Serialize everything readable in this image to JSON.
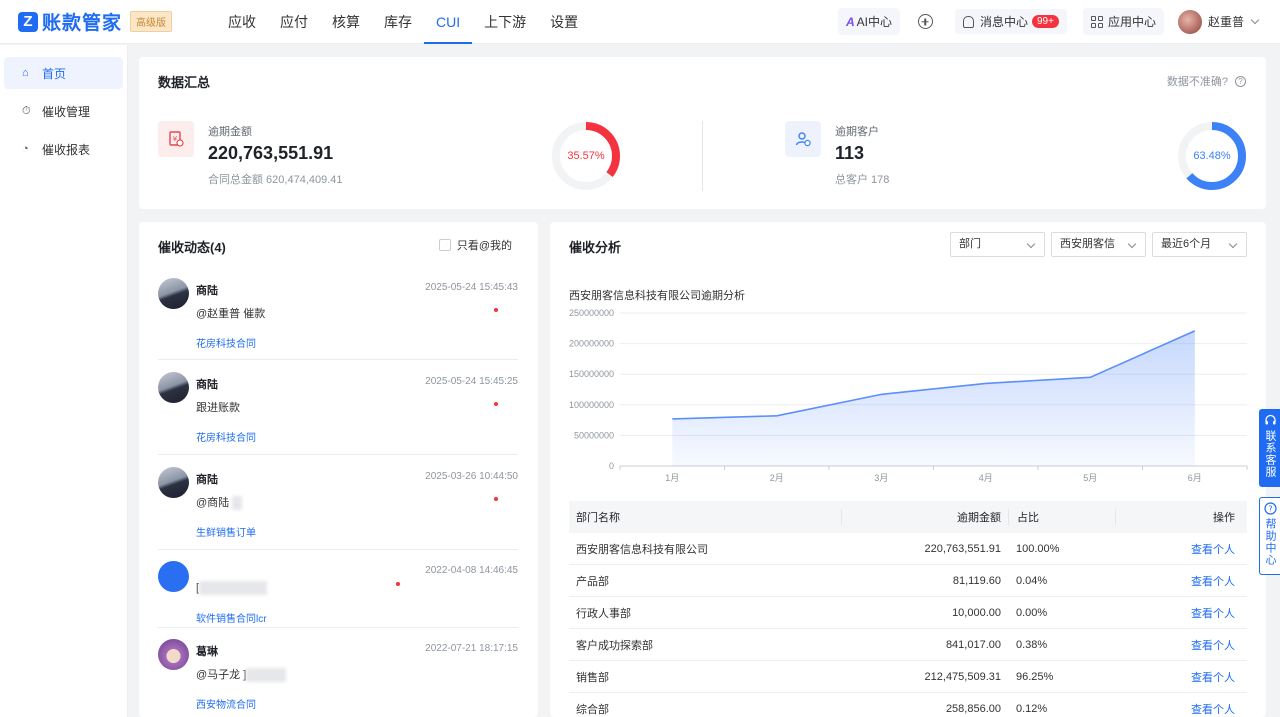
{
  "app": {
    "logo_mark": "Z",
    "name": "账款管家",
    "badge": "高级版"
  },
  "nav": [
    "应收",
    "应付",
    "核算",
    "库存",
    "CUI",
    "上下游",
    "设置"
  ],
  "nav_active": "CUI",
  "topright": {
    "ai_icon": "A",
    "ai_label": "AI中心",
    "msg_label": "消息中心",
    "msg_badge": "99+",
    "app_label": "应用中心",
    "user_name": "赵重普"
  },
  "sidebar": [
    {
      "icon": "home-icon",
      "glyph": "⌂",
      "label": "首页",
      "active": true
    },
    {
      "icon": "timer-icon",
      "glyph": "⏱",
      "label": "催收管理",
      "active": false
    },
    {
      "icon": "report-icon",
      "glyph": "◔",
      "label": "催收报表",
      "active": false
    }
  ],
  "summary": {
    "title": "数据汇总",
    "inaccurate": "数据不准确?",
    "overdue_amount": {
      "label": "逾期金额",
      "value": "220,763,551.91",
      "sub": "合同总金额 620,474,409.41",
      "percent_text": "35.57%",
      "percent": 35.57,
      "color": "#f5333f"
    },
    "overdue_customers": {
      "label": "逾期客户",
      "value": "113",
      "sub": "总客户 178",
      "percent_text": "63.48%",
      "percent": 63.48,
      "color": "#3c82f6"
    }
  },
  "activity": {
    "title": "催收动态(4)",
    "only_me": "只看@我的",
    "items": [
      {
        "name": "商陆",
        "time": "2025-05-24 15:45:43",
        "text": "@赵重普 催款",
        "link": "花房科技合同"
      },
      {
        "name": "商陆",
        "time": "2025-05-24 15:45:25",
        "text": "跟进账款",
        "link": "花房科技合同"
      },
      {
        "name": "商陆",
        "time": "2025-03-26 10:44:50",
        "text": "@商陆 ",
        "link": "生鲜销售订单"
      },
      {
        "name": "",
        "time": "2022-04-08 14:46:45",
        "text": "[",
        "link": "软件销售合同lcr"
      },
      {
        "name": "葛琳",
        "time": "2022-07-21 18:17:15",
        "text": "@马子龙 ]",
        "link": "西安物流合同"
      }
    ]
  },
  "analysis": {
    "title": "催收分析",
    "filters": [
      "部门",
      "西安朋客信",
      "最近6个月"
    ],
    "table": {
      "headers": [
        "部门名称",
        "逾期金额",
        "占比",
        "操作"
      ],
      "rows": [
        [
          "西安朋客信息科技有限公司",
          "220,763,551.91",
          "100.00%",
          "查看个人"
        ],
        [
          "产品部",
          "81,119.60",
          "0.04%",
          "查看个人"
        ],
        [
          "行政人事部",
          "10,000.00",
          "0.00%",
          "查看个人"
        ],
        [
          "客户成功探索部",
          "841,017.00",
          "0.38%",
          "查看个人"
        ],
        [
          "销售部",
          "212,475,509.31",
          "96.25%",
          "查看个人"
        ],
        [
          "综合部",
          "258,856.00",
          "0.12%",
          "查看个人"
        ]
      ]
    }
  },
  "chart_data": {
    "type": "area",
    "title": "西安朋客信息科技有限公司逾期分析",
    "categories": [
      "1月",
      "2月",
      "3月",
      "4月",
      "5月",
      "6月"
    ],
    "values": [
      77000000,
      82000000,
      117000000,
      135000000,
      145000000,
      220763551.91
    ],
    "ylim": [
      0,
      250000000
    ],
    "yticks": [
      "0",
      "50000000",
      "100000000",
      "150000000",
      "200000000",
      "250000000"
    ],
    "grid": true,
    "color": "#5b8ff9"
  },
  "float_buttons": [
    "联系客服",
    "帮助中心"
  ]
}
